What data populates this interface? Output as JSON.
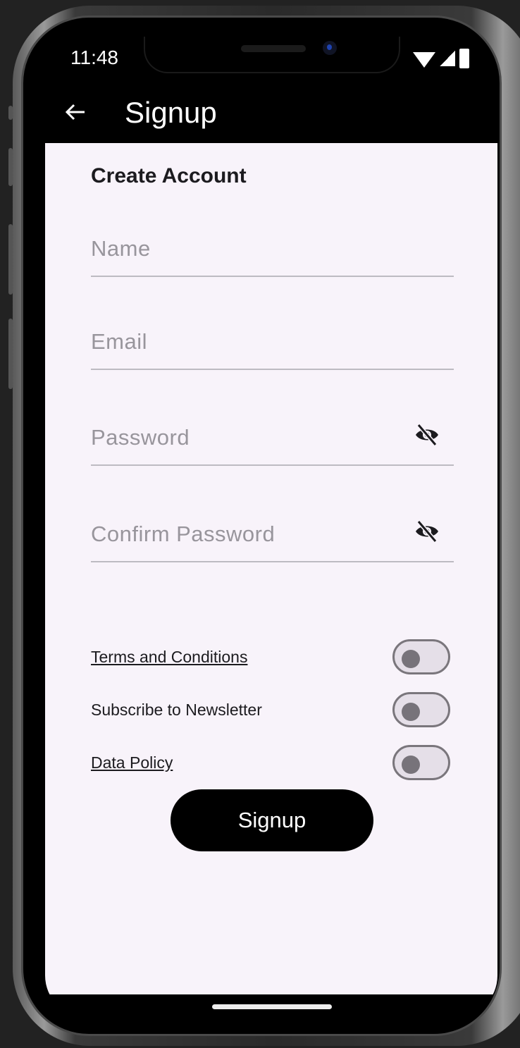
{
  "status_bar": {
    "time": "11:48",
    "icons": [
      "wifi-icon",
      "signal-icon",
      "battery-icon"
    ]
  },
  "app_bar": {
    "back_icon": "arrow-left-icon",
    "title": "Signup"
  },
  "form": {
    "heading": "Create Account",
    "fields": [
      {
        "label": "Name",
        "value": ""
      },
      {
        "label": "Email",
        "value": ""
      },
      {
        "label": "Password",
        "value": "",
        "icon": "eye-off-icon"
      },
      {
        "label": "Confirm Password",
        "value": "",
        "icon": "eye-off-icon"
      }
    ],
    "options": [
      {
        "label": "Terms and Conditions",
        "link": true,
        "checked": false
      },
      {
        "label": "Subscribe to Newsletter",
        "link": false,
        "checked": false
      },
      {
        "label": "Data Policy",
        "link": true,
        "checked": false
      }
    ],
    "submit_label": "Signup"
  },
  "colors": {
    "background": "#f8f3fa",
    "primary": "#000000",
    "label_text": "#98959c",
    "switch_track": "#e5dfe8"
  }
}
